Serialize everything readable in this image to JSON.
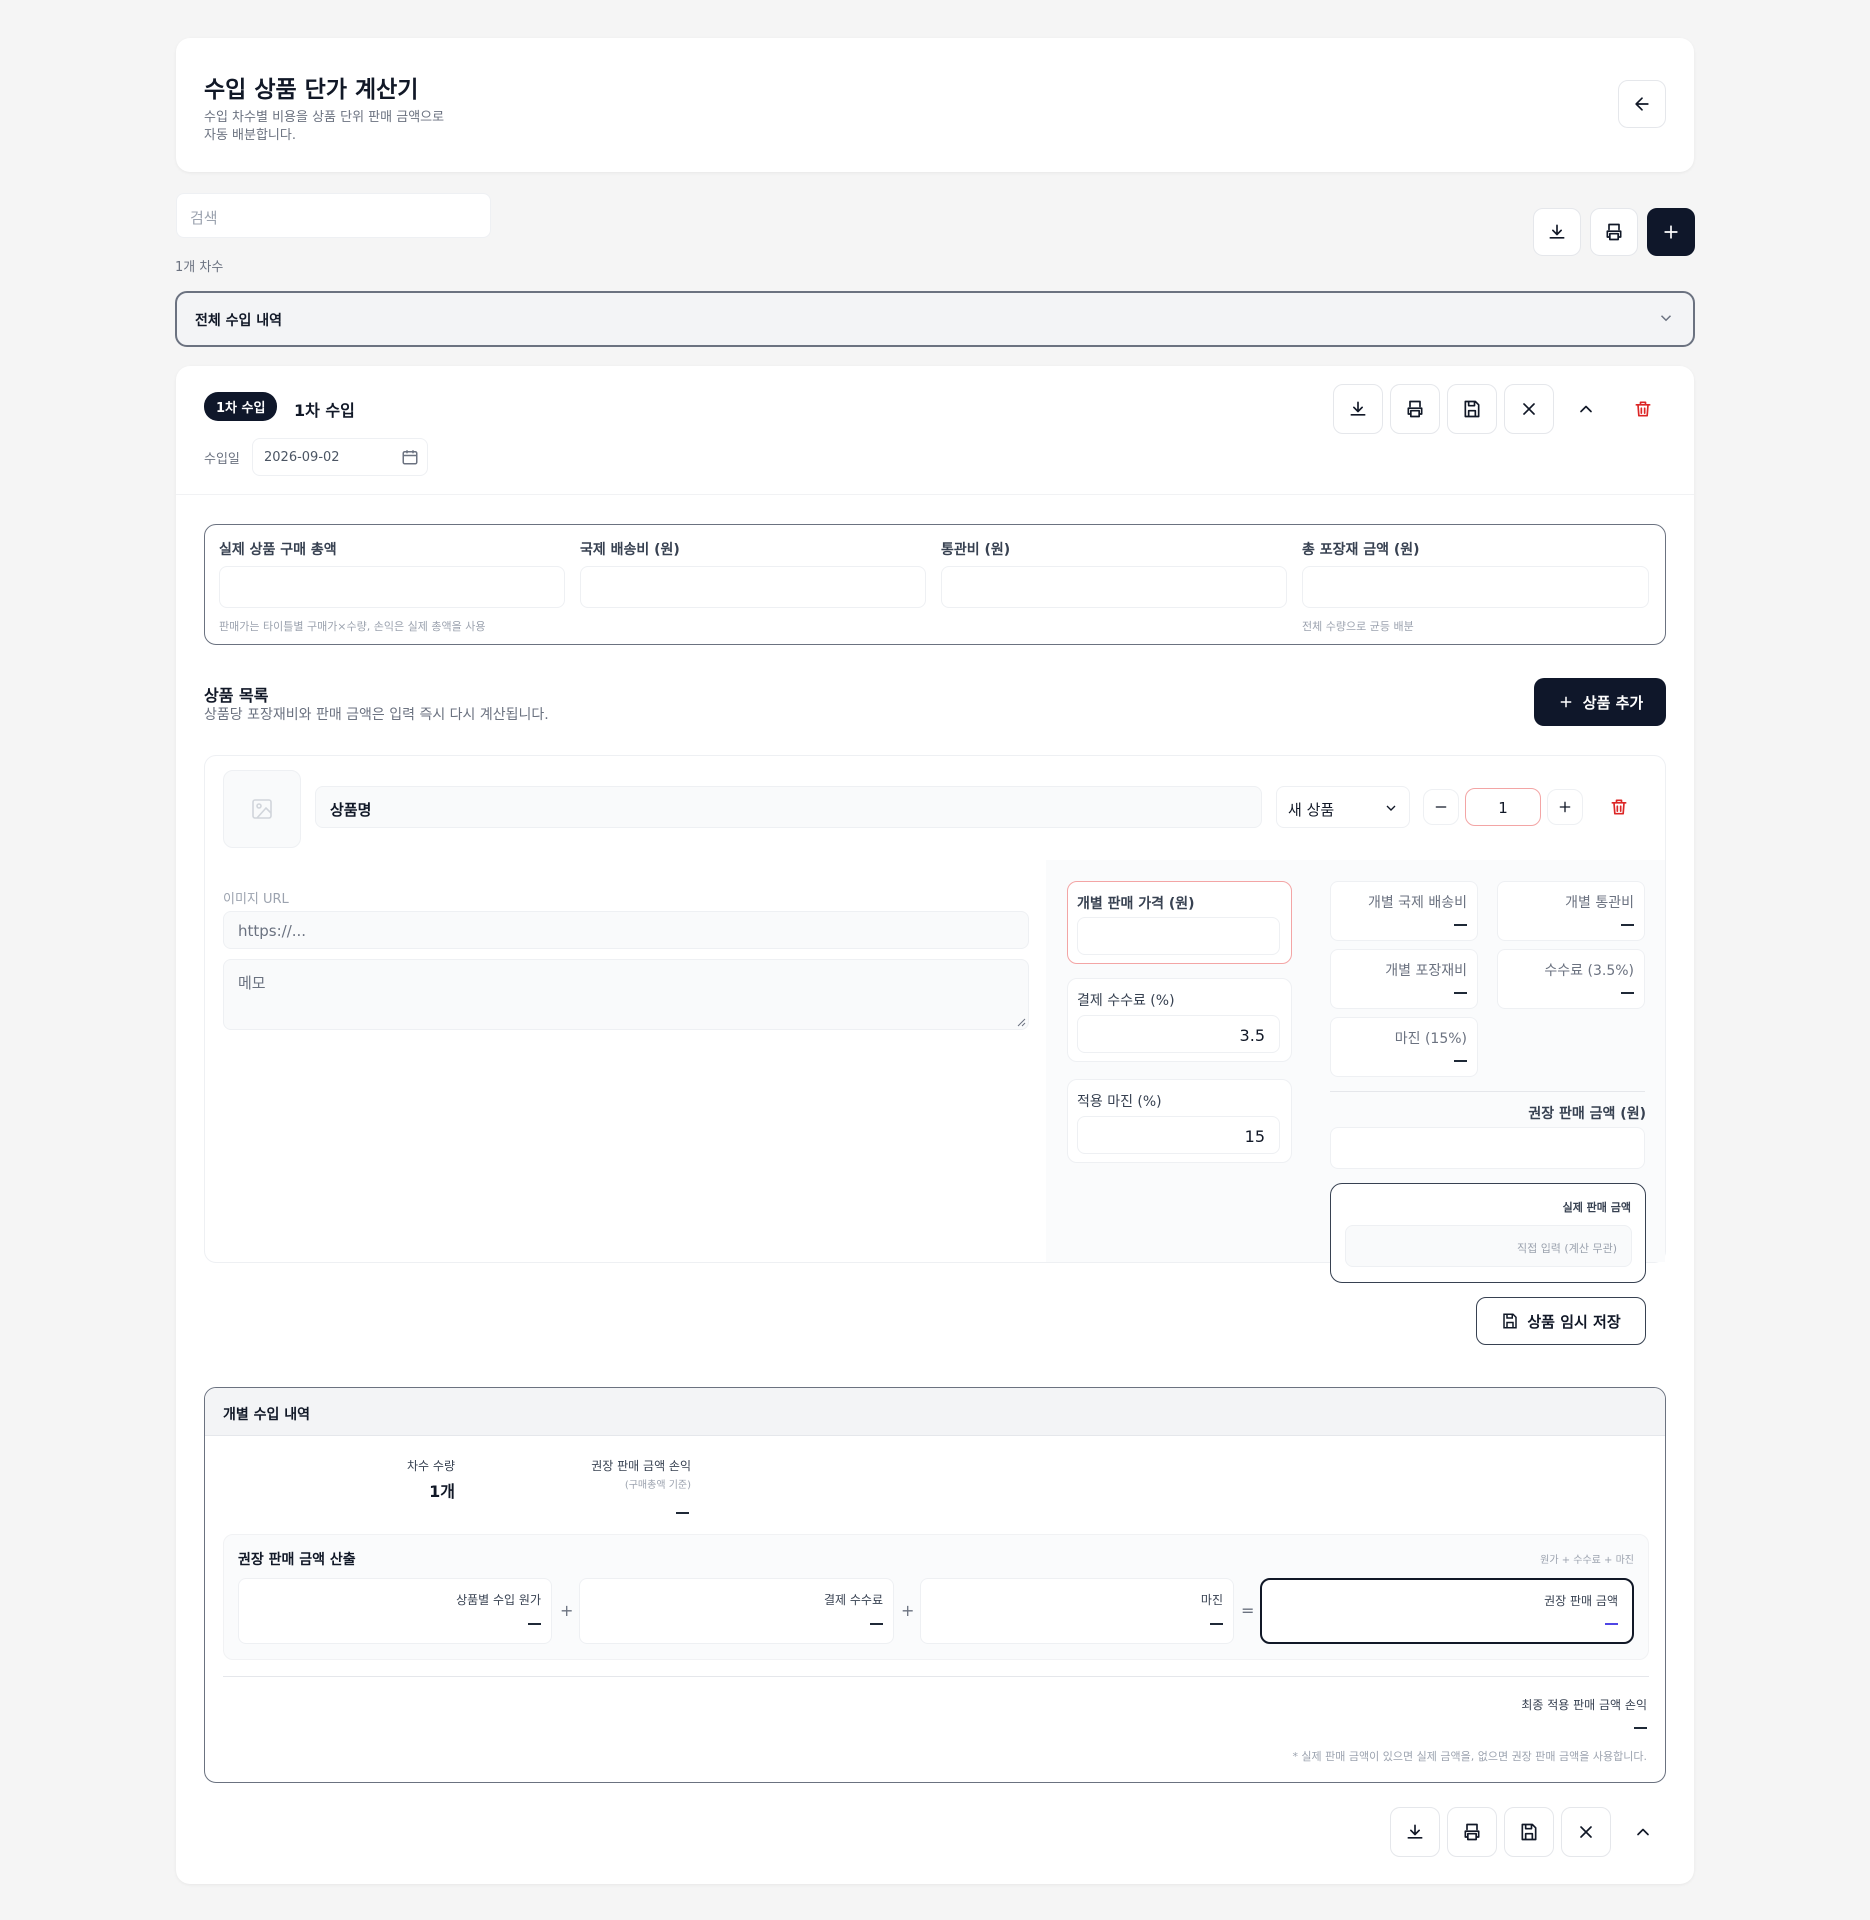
{
  "header": {
    "title": "수입 상품 단가 계산기",
    "subtitle_line1": "수입 차수별 비용을 상품 단위 판매 금액으로",
    "subtitle_line2": "자동 배분합니다."
  },
  "search": {
    "placeholder": "검색"
  },
  "batch_count": "1개 차수",
  "all_imports": {
    "label": "전체 수입 내역"
  },
  "batch": {
    "badge": "1차 수입",
    "title": "1차 수입",
    "date_label": "수입일",
    "date_value": "2026-09-02"
  },
  "costs": {
    "purchase_total_label": "실제 상품 구매 총액",
    "shipping_label": "국제 배송비 (원)",
    "customs_label": "통관비 (원)",
    "packaging_label": "총 포장재 금액 (원)",
    "purchase_hint": "판매가는 타이틀별 구매가×수량, 손익은 실제 총액을 사용",
    "packaging_hint": "전체 수량으로 균등 배분"
  },
  "products": {
    "title": "상품 목록",
    "subtitle": "상품당 포장재비와 판매 금액은 입력 즉시 다시 계산됩니다.",
    "add_button": "상품 추가"
  },
  "product": {
    "name_placeholder": "상품명",
    "status_select": "새 상품",
    "quantity": "1",
    "image_url_label": "이미지 URL",
    "image_url_placeholder": "https://...",
    "memo_placeholder": "메모",
    "unit_price_label": "개별 판매 가격 (원)",
    "payment_fee_label": "결제 수수료 (%)",
    "payment_fee_value": "3.5",
    "margin_label": "적용 마진 (%)",
    "margin_value": "15",
    "stats": {
      "shipping": "개별 국제 배송비",
      "customs": "개별 통관비",
      "packaging": "개별 포장재비",
      "fee": "수수료 (3.5%)",
      "margin": "마진 (15%)"
    },
    "recommended_label": "권장 판매 금액 (원)",
    "actual_price_label": "실제 판매 금액",
    "actual_price_placeholder": "직접 입력 (계산 무관)",
    "temp_save_button": "상품 임시 저장"
  },
  "individual": {
    "title": "개별 수입 내역",
    "qty_label": "차수 수량",
    "qty_value": "1개",
    "profit_label": "권장 판매 금액 손익",
    "profit_sub": "(구매총액 기준)",
    "calc_title": "권장 판매 금액 산출",
    "calc_formula": "원가 + 수수료 + 마진",
    "cost_label": "상품별 수입 원가",
    "fee_label": "결제 수수료",
    "margin_label": "마진",
    "result_label": "권장 판매 금액",
    "plus": "+",
    "equals": "=",
    "final_label": "최종 적용 판매 금액 손익",
    "footnote": "* 실제 판매 금액이 있으면 실제 금액을, 없으면 권장 판매 금액을 사용합니다."
  },
  "colors": {
    "dark": "#0f172a",
    "danger": "#dc2626",
    "highlight_border": "#f3a5a5",
    "background": "#f5f5f5"
  },
  "icons": [
    "arrow-left-icon",
    "download-icon",
    "print-icon",
    "plus-icon",
    "chevron-down-icon",
    "save-icon",
    "close-icon",
    "chevron-up-icon",
    "trash-icon",
    "calendar-icon",
    "image-placeholder-icon",
    "minus-icon"
  ]
}
